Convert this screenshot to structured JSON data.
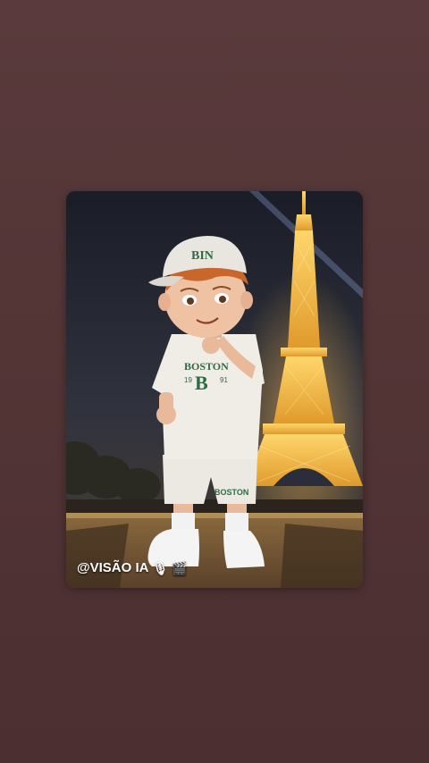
{
  "post": {
    "watermark_text": "@VISÃO IA",
    "watermark_icons": [
      "microphone-icon",
      "clapperboard-icon"
    ],
    "cap_text": "BIN",
    "shirt_text": "BOSTON",
    "shirt_number_left": "19",
    "shirt_number_right": "91",
    "shirt_letter": "B",
    "shorts_text": "BOSTON"
  },
  "colors": {
    "background": "#533536",
    "tower": "#f2b441",
    "outfit_accent": "#2f6b45"
  }
}
